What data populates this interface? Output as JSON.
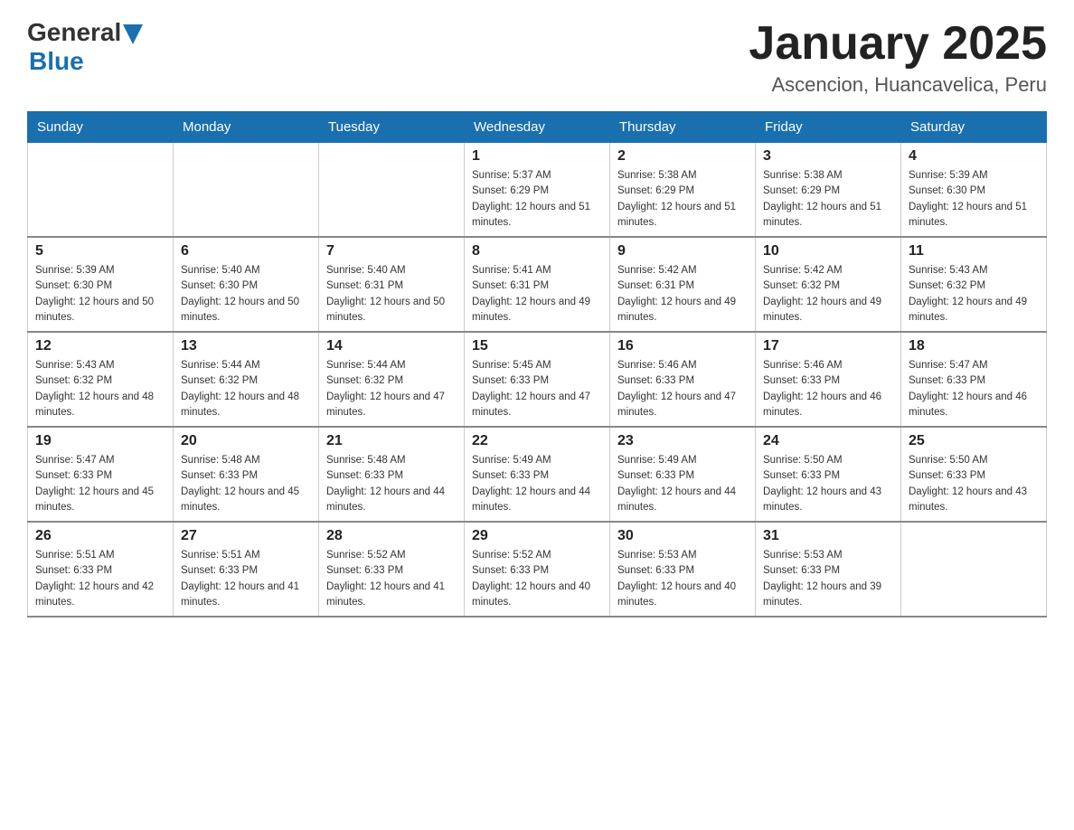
{
  "header": {
    "logo_general": "General",
    "logo_blue": "Blue",
    "title": "January 2025",
    "subtitle": "Ascencion, Huancavelica, Peru"
  },
  "weekdays": [
    "Sunday",
    "Monday",
    "Tuesday",
    "Wednesday",
    "Thursday",
    "Friday",
    "Saturday"
  ],
  "weeks": [
    [
      {
        "day": "",
        "sunrise": "",
        "sunset": "",
        "daylight": ""
      },
      {
        "day": "",
        "sunrise": "",
        "sunset": "",
        "daylight": ""
      },
      {
        "day": "",
        "sunrise": "",
        "sunset": "",
        "daylight": ""
      },
      {
        "day": "1",
        "sunrise": "Sunrise: 5:37 AM",
        "sunset": "Sunset: 6:29 PM",
        "daylight": "Daylight: 12 hours and 51 minutes."
      },
      {
        "day": "2",
        "sunrise": "Sunrise: 5:38 AM",
        "sunset": "Sunset: 6:29 PM",
        "daylight": "Daylight: 12 hours and 51 minutes."
      },
      {
        "day": "3",
        "sunrise": "Sunrise: 5:38 AM",
        "sunset": "Sunset: 6:29 PM",
        "daylight": "Daylight: 12 hours and 51 minutes."
      },
      {
        "day": "4",
        "sunrise": "Sunrise: 5:39 AM",
        "sunset": "Sunset: 6:30 PM",
        "daylight": "Daylight: 12 hours and 51 minutes."
      }
    ],
    [
      {
        "day": "5",
        "sunrise": "Sunrise: 5:39 AM",
        "sunset": "Sunset: 6:30 PM",
        "daylight": "Daylight: 12 hours and 50 minutes."
      },
      {
        "day": "6",
        "sunrise": "Sunrise: 5:40 AM",
        "sunset": "Sunset: 6:30 PM",
        "daylight": "Daylight: 12 hours and 50 minutes."
      },
      {
        "day": "7",
        "sunrise": "Sunrise: 5:40 AM",
        "sunset": "Sunset: 6:31 PM",
        "daylight": "Daylight: 12 hours and 50 minutes."
      },
      {
        "day": "8",
        "sunrise": "Sunrise: 5:41 AM",
        "sunset": "Sunset: 6:31 PM",
        "daylight": "Daylight: 12 hours and 49 minutes."
      },
      {
        "day": "9",
        "sunrise": "Sunrise: 5:42 AM",
        "sunset": "Sunset: 6:31 PM",
        "daylight": "Daylight: 12 hours and 49 minutes."
      },
      {
        "day": "10",
        "sunrise": "Sunrise: 5:42 AM",
        "sunset": "Sunset: 6:32 PM",
        "daylight": "Daylight: 12 hours and 49 minutes."
      },
      {
        "day": "11",
        "sunrise": "Sunrise: 5:43 AM",
        "sunset": "Sunset: 6:32 PM",
        "daylight": "Daylight: 12 hours and 49 minutes."
      }
    ],
    [
      {
        "day": "12",
        "sunrise": "Sunrise: 5:43 AM",
        "sunset": "Sunset: 6:32 PM",
        "daylight": "Daylight: 12 hours and 48 minutes."
      },
      {
        "day": "13",
        "sunrise": "Sunrise: 5:44 AM",
        "sunset": "Sunset: 6:32 PM",
        "daylight": "Daylight: 12 hours and 48 minutes."
      },
      {
        "day": "14",
        "sunrise": "Sunrise: 5:44 AM",
        "sunset": "Sunset: 6:32 PM",
        "daylight": "Daylight: 12 hours and 47 minutes."
      },
      {
        "day": "15",
        "sunrise": "Sunrise: 5:45 AM",
        "sunset": "Sunset: 6:33 PM",
        "daylight": "Daylight: 12 hours and 47 minutes."
      },
      {
        "day": "16",
        "sunrise": "Sunrise: 5:46 AM",
        "sunset": "Sunset: 6:33 PM",
        "daylight": "Daylight: 12 hours and 47 minutes."
      },
      {
        "day": "17",
        "sunrise": "Sunrise: 5:46 AM",
        "sunset": "Sunset: 6:33 PM",
        "daylight": "Daylight: 12 hours and 46 minutes."
      },
      {
        "day": "18",
        "sunrise": "Sunrise: 5:47 AM",
        "sunset": "Sunset: 6:33 PM",
        "daylight": "Daylight: 12 hours and 46 minutes."
      }
    ],
    [
      {
        "day": "19",
        "sunrise": "Sunrise: 5:47 AM",
        "sunset": "Sunset: 6:33 PM",
        "daylight": "Daylight: 12 hours and 45 minutes."
      },
      {
        "day": "20",
        "sunrise": "Sunrise: 5:48 AM",
        "sunset": "Sunset: 6:33 PM",
        "daylight": "Daylight: 12 hours and 45 minutes."
      },
      {
        "day": "21",
        "sunrise": "Sunrise: 5:48 AM",
        "sunset": "Sunset: 6:33 PM",
        "daylight": "Daylight: 12 hours and 44 minutes."
      },
      {
        "day": "22",
        "sunrise": "Sunrise: 5:49 AM",
        "sunset": "Sunset: 6:33 PM",
        "daylight": "Daylight: 12 hours and 44 minutes."
      },
      {
        "day": "23",
        "sunrise": "Sunrise: 5:49 AM",
        "sunset": "Sunset: 6:33 PM",
        "daylight": "Daylight: 12 hours and 44 minutes."
      },
      {
        "day": "24",
        "sunrise": "Sunrise: 5:50 AM",
        "sunset": "Sunset: 6:33 PM",
        "daylight": "Daylight: 12 hours and 43 minutes."
      },
      {
        "day": "25",
        "sunrise": "Sunrise: 5:50 AM",
        "sunset": "Sunset: 6:33 PM",
        "daylight": "Daylight: 12 hours and 43 minutes."
      }
    ],
    [
      {
        "day": "26",
        "sunrise": "Sunrise: 5:51 AM",
        "sunset": "Sunset: 6:33 PM",
        "daylight": "Daylight: 12 hours and 42 minutes."
      },
      {
        "day": "27",
        "sunrise": "Sunrise: 5:51 AM",
        "sunset": "Sunset: 6:33 PM",
        "daylight": "Daylight: 12 hours and 41 minutes."
      },
      {
        "day": "28",
        "sunrise": "Sunrise: 5:52 AM",
        "sunset": "Sunset: 6:33 PM",
        "daylight": "Daylight: 12 hours and 41 minutes."
      },
      {
        "day": "29",
        "sunrise": "Sunrise: 5:52 AM",
        "sunset": "Sunset: 6:33 PM",
        "daylight": "Daylight: 12 hours and 40 minutes."
      },
      {
        "day": "30",
        "sunrise": "Sunrise: 5:53 AM",
        "sunset": "Sunset: 6:33 PM",
        "daylight": "Daylight: 12 hours and 40 minutes."
      },
      {
        "day": "31",
        "sunrise": "Sunrise: 5:53 AM",
        "sunset": "Sunset: 6:33 PM",
        "daylight": "Daylight: 12 hours and 39 minutes."
      },
      {
        "day": "",
        "sunrise": "",
        "sunset": "",
        "daylight": ""
      }
    ]
  ]
}
